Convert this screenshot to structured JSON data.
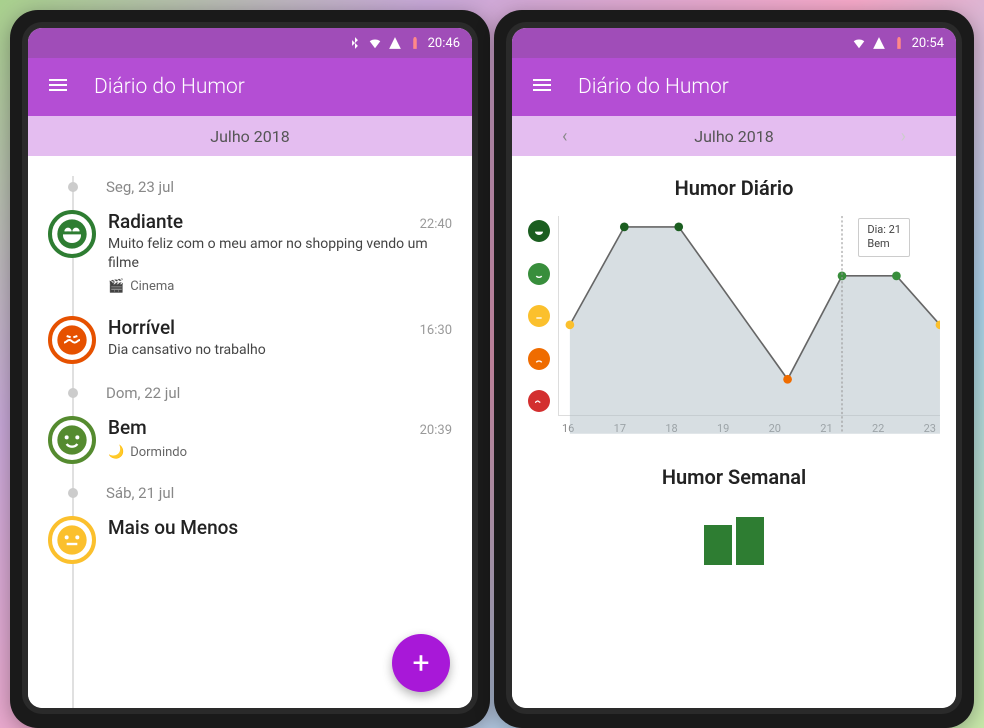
{
  "status_bar": {
    "time_left": "20:46",
    "time_right": "20:54"
  },
  "app": {
    "title": "Diário do Humor"
  },
  "month_bar": {
    "label": "Julho 2018"
  },
  "timeline": {
    "groups": [
      {
        "date": "Seg, 23 jul",
        "entries": [
          {
            "mood": "radiante",
            "title": "Radiante",
            "time": "22:40",
            "desc": "Muito feliz com o meu amor no shopping vendo um filme",
            "tag_icon": "cinema-icon",
            "tag_label": "Cinema"
          },
          {
            "mood": "horrivel",
            "title": "Horrível",
            "time": "16:30",
            "desc": "Dia cansativo no trabalho"
          }
        ]
      },
      {
        "date": "Dom, 22 jul",
        "entries": [
          {
            "mood": "bem",
            "title": "Bem",
            "time": "20:39",
            "tag_icon": "sleep-icon",
            "tag_label": "Dormindo"
          }
        ]
      },
      {
        "date": "Sáb, 21 jul",
        "entries": [
          {
            "mood": "mais-ou-menos",
            "title": "Mais ou Menos"
          }
        ]
      }
    ]
  },
  "fab": {
    "label": "+"
  },
  "charts": {
    "daily_title": "Humor Diário",
    "weekly_title": "Humor Semanal",
    "tooltip": {
      "line1": "Dia: 21",
      "line2": "Bem"
    }
  },
  "chart_data": {
    "type": "line",
    "title": "Humor Diário",
    "xlabel": "",
    "ylabel": "",
    "x": [
      16,
      17,
      18,
      19,
      20,
      21,
      22,
      23
    ],
    "y_categories": [
      "Horrível",
      "Mal",
      "Mais ou Menos",
      "Bem",
      "Radiante"
    ],
    "values_index": [
      2,
      4,
      4,
      null,
      1,
      3,
      3,
      2
    ],
    "annotations": [
      {
        "x": 21,
        "text": "Dia: 21 Bem"
      }
    ],
    "y_colors": [
      "#d32f2f",
      "#ef6c00",
      "#fbc02d",
      "#388e3c",
      "#1b5e20"
    ]
  },
  "x_ticks": {
    "t0": "16",
    "t1": "17",
    "t2": "18",
    "t3": "19",
    "t4": "20",
    "t5": "21",
    "t6": "22",
    "t7": "23"
  }
}
